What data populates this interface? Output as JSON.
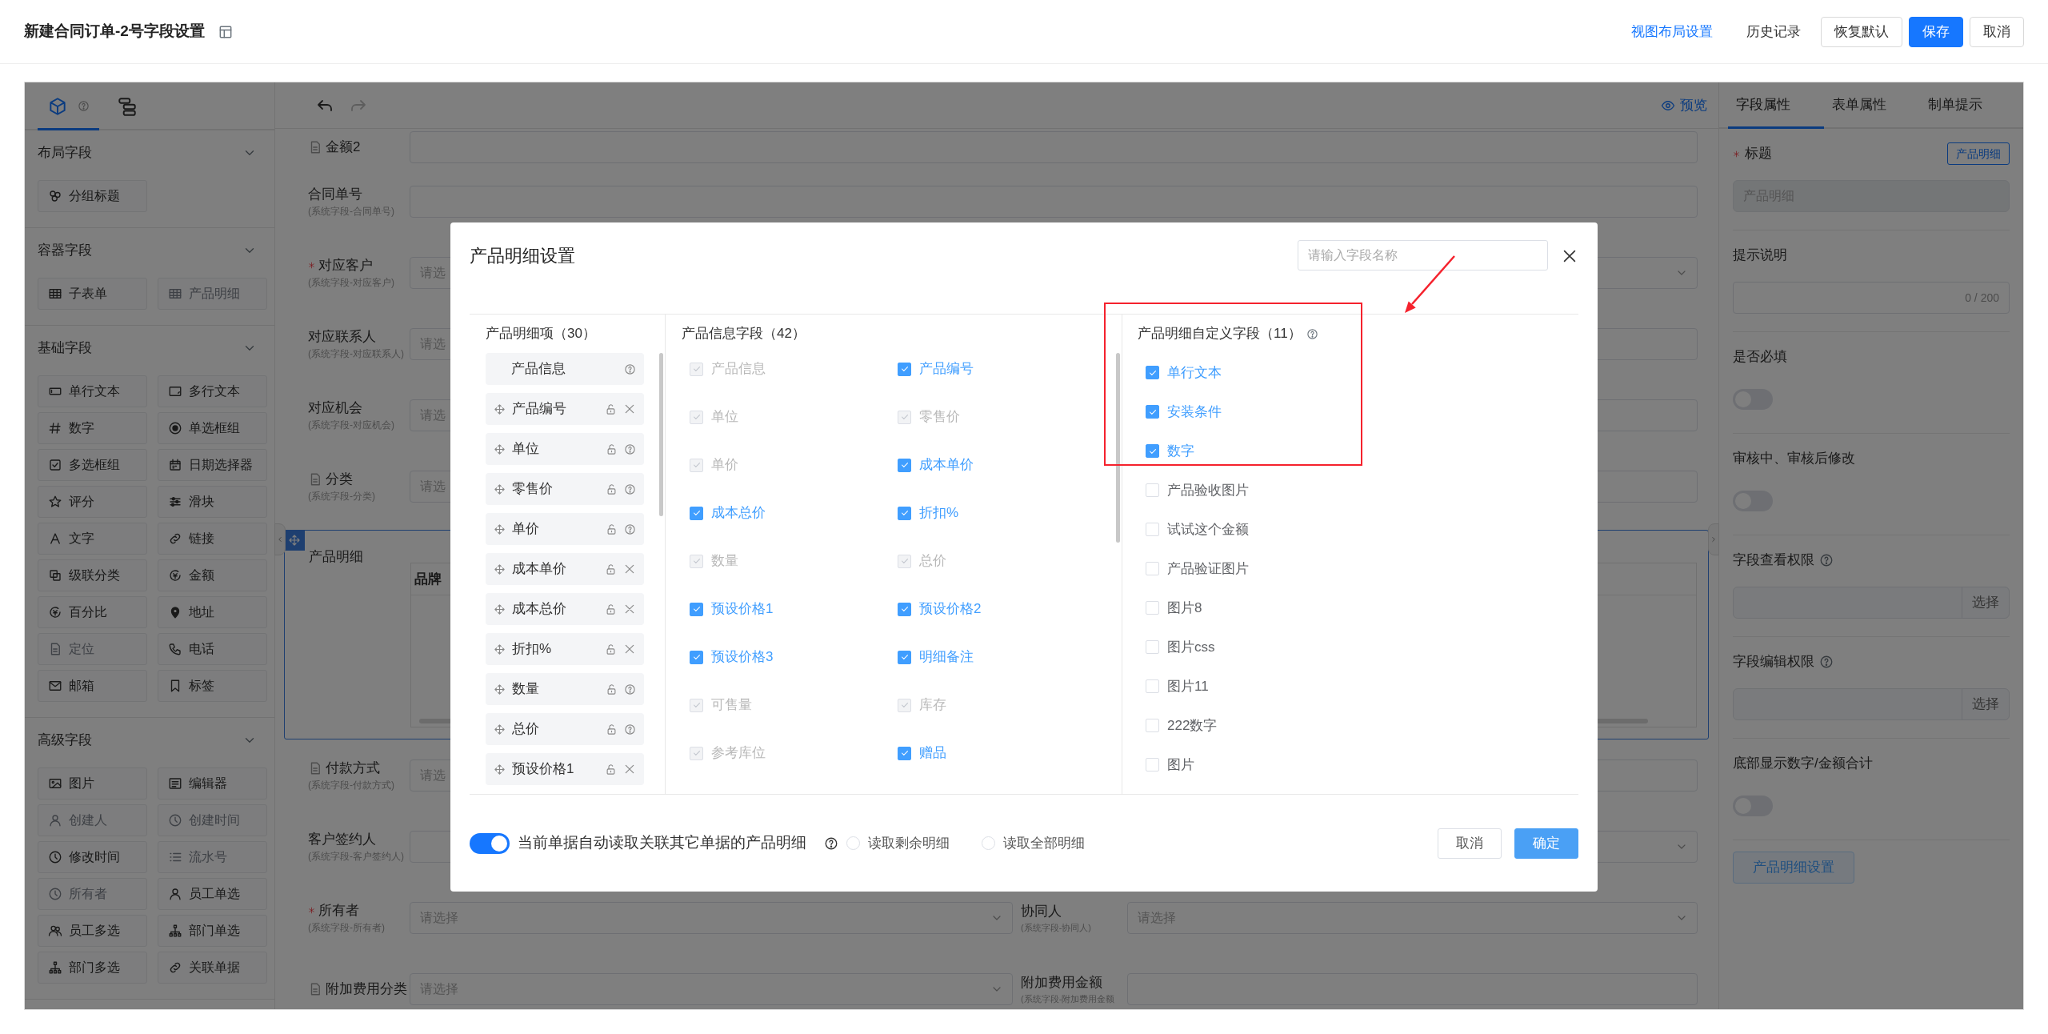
{
  "header": {
    "title": "新建合同订单-2号字段设置",
    "actions": [
      {
        "label": "视图布局设置",
        "kind": "link"
      },
      {
        "label": "历史记录",
        "kind": "text"
      },
      {
        "label": "恢复默认",
        "kind": "outline"
      },
      {
        "label": "保存",
        "kind": "primary"
      },
      {
        "label": "取消",
        "kind": "outline"
      }
    ]
  },
  "sidebar": {
    "tabs": [
      {
        "selected": true
      },
      {
        "selected": false
      }
    ],
    "sections": [
      {
        "title": "布局字段",
        "expanded": true,
        "items": [
          {
            "label": "分组标题",
            "disabled": false
          }
        ]
      },
      {
        "title": "容器字段",
        "expanded": true,
        "items": [
          {
            "label": "子表单",
            "disabled": false
          },
          {
            "label": "产品明细",
            "disabled": true
          }
        ]
      },
      {
        "title": "基础字段",
        "expanded": true,
        "items": [
          {
            "label": "单行文本",
            "disabled": false
          },
          {
            "label": "多行文本",
            "disabled": false
          },
          {
            "label": "数字",
            "disabled": false
          },
          {
            "label": "单选框组",
            "disabled": false
          },
          {
            "label": "多选框组",
            "disabled": false
          },
          {
            "label": "日期选择器",
            "disabled": false
          },
          {
            "label": "评分",
            "disabled": false
          },
          {
            "label": "滑块",
            "disabled": false
          },
          {
            "label": "文字",
            "disabled": false
          },
          {
            "label": "链接",
            "disabled": false
          },
          {
            "label": "级联分类",
            "disabled": false
          },
          {
            "label": "金额",
            "disabled": false
          },
          {
            "label": "百分比",
            "disabled": false
          },
          {
            "label": "地址",
            "disabled": false
          },
          {
            "label": "定位",
            "disabled": true
          },
          {
            "label": "电话",
            "disabled": false
          },
          {
            "label": "邮箱",
            "disabled": false
          },
          {
            "label": "标签",
            "disabled": false
          }
        ]
      },
      {
        "title": "高级字段",
        "expanded": true,
        "items": [
          {
            "label": "图片",
            "disabled": false
          },
          {
            "label": "编辑器",
            "disabled": false
          },
          {
            "label": "创建人",
            "disabled": true
          },
          {
            "label": "创建时间",
            "disabled": true
          },
          {
            "label": "修改时间",
            "disabled": false
          },
          {
            "label": "流水号",
            "disabled": true
          },
          {
            "label": "所有者",
            "disabled": true
          },
          {
            "label": "员工单选",
            "disabled": false
          },
          {
            "label": "员工多选",
            "disabled": false
          },
          {
            "label": "部门单选",
            "disabled": false
          },
          {
            "label": "部门多选",
            "disabled": false
          },
          {
            "label": "关联单据",
            "disabled": false
          }
        ]
      }
    ]
  },
  "canvas": {
    "preview": "预览",
    "rows": [
      {
        "kind": "full",
        "label": "金额2",
        "note": true
      },
      {
        "kind": "full",
        "label": "合同单号",
        "sub": "(系统字段-合同单号)"
      },
      {
        "kind": "pair",
        "label": "对应客户",
        "required": true,
        "sub": "(系统字段-对应客户)",
        "placeholder": "请选",
        "right": {
          "dropdown": true
        }
      },
      {
        "kind": "pair",
        "label": "对应联系人",
        "sub": "(系统字段-对应联系人)",
        "placeholder": "请选",
        "right": {}
      },
      {
        "kind": "pair",
        "label": "对应机会",
        "sub": "(系统字段-对应机会)",
        "placeholder": "请选",
        "right": {}
      },
      {
        "kind": "pair",
        "label": "分类",
        "note": true,
        "sub": "(系统字段-分类)",
        "placeholder": "请选",
        "right": {}
      },
      {
        "kind": "table",
        "label": "产品明细",
        "selected": true,
        "columns": [
          "品牌"
        ]
      },
      {
        "kind": "pair",
        "label": "付款方式",
        "note": true,
        "sub": "(系统字段-付款方式)",
        "placeholder": "请选",
        "right": {}
      },
      {
        "kind": "pair",
        "label": "客户签约人",
        "sub": "(系统字段-客户签约人)",
        "right": {
          "dropdown": true
        }
      },
      {
        "kind": "pair",
        "label": "所有者",
        "required": true,
        "sub": "(系统字段-所有者)",
        "placeholder": "请选择",
        "dropdown": true,
        "right": {
          "label": "协同人",
          "sub": "(系统字段-协同人)",
          "placeholder": "请选择",
          "dropdown": true
        }
      },
      {
        "kind": "pair",
        "label": "附加费用分类",
        "note": true,
        "placeholder": "请选择",
        "dropdown": true,
        "right": {
          "label": "附加费用金额",
          "sub": "(系统字段-附加费用金额"
        }
      }
    ]
  },
  "properties": {
    "tabs": [
      {
        "label": "字段属性",
        "selected": true
      },
      {
        "label": "表单属性",
        "selected": false
      },
      {
        "label": "制单提示",
        "selected": false
      }
    ],
    "items": [
      {
        "kind": "title",
        "label": "标题",
        "required": true,
        "tag": "产品明细",
        "value": "产品明细"
      },
      {
        "kind": "textarea",
        "label": "提示说明",
        "counter": "0 / 200"
      },
      {
        "kind": "switch",
        "label": "是否必填",
        "on": false
      },
      {
        "kind": "switch",
        "label": "审核中、审核后修改",
        "on": false
      },
      {
        "kind": "picker",
        "label": "字段查看权限",
        "help": true,
        "button": "选择"
      },
      {
        "kind": "picker",
        "label": "字段编辑权限",
        "help": true,
        "button": "选择"
      },
      {
        "kind": "switch",
        "label": "底部显示数字/金额合计",
        "on": false
      },
      {
        "kind": "button",
        "label": "产品明细设置"
      }
    ]
  },
  "modal": {
    "title": "产品明细设置",
    "search": {
      "placeholder": "请输入字段名称"
    },
    "columns": [
      {
        "kind": "order",
        "title": "产品明细项（30）",
        "items": [
          {
            "label": "产品信息",
            "draggable": false,
            "removable": false
          },
          {
            "label": "产品编号",
            "draggable": true,
            "removable": true
          },
          {
            "label": "单位",
            "draggable": true,
            "removable": false
          },
          {
            "label": "零售价",
            "draggable": true,
            "removable": false
          },
          {
            "label": "单价",
            "draggable": true,
            "removable": false
          },
          {
            "label": "成本单价",
            "draggable": true,
            "removable": true
          },
          {
            "label": "成本总价",
            "draggable": true,
            "removable": true
          },
          {
            "label": "折扣%",
            "draggable": true,
            "removable": true
          },
          {
            "label": "数量",
            "draggable": true,
            "removable": false
          },
          {
            "label": "总价",
            "draggable": true,
            "removable": false
          },
          {
            "label": "预设价格1",
            "draggable": true,
            "removable": true
          }
        ]
      },
      {
        "kind": "grid",
        "title": "产品信息字段（42）",
        "items": [
          {
            "label": "产品信息",
            "checked": true,
            "disabled": true
          },
          {
            "label": "产品编号",
            "checked": true,
            "disabled": false
          },
          {
            "label": "单位",
            "checked": true,
            "disabled": true
          },
          {
            "label": "零售价",
            "checked": true,
            "disabled": true
          },
          {
            "label": "单价",
            "checked": true,
            "disabled": true
          },
          {
            "label": "成本单价",
            "checked": true,
            "disabled": false
          },
          {
            "label": "成本总价",
            "checked": true,
            "disabled": false
          },
          {
            "label": "折扣%",
            "checked": true,
            "disabled": false
          },
          {
            "label": "数量",
            "checked": true,
            "disabled": true
          },
          {
            "label": "总价",
            "checked": true,
            "disabled": true
          },
          {
            "label": "预设价格1",
            "checked": true,
            "disabled": false
          },
          {
            "label": "预设价格2",
            "checked": true,
            "disabled": false
          },
          {
            "label": "预设价格3",
            "checked": true,
            "disabled": false
          },
          {
            "label": "明细备注",
            "checked": true,
            "disabled": false
          },
          {
            "label": "可售量",
            "checked": true,
            "disabled": true
          },
          {
            "label": "库存",
            "checked": true,
            "disabled": true
          },
          {
            "label": "参考库位",
            "checked": true,
            "disabled": true
          },
          {
            "label": "赠品",
            "checked": true,
            "disabled": false
          }
        ]
      },
      {
        "kind": "list",
        "title": "产品明细自定义字段（11）",
        "help": true,
        "items": [
          {
            "label": "单行文本",
            "checked": true
          },
          {
            "label": "安装条件",
            "checked": true
          },
          {
            "label": "数字",
            "checked": true
          },
          {
            "label": "产品验收图片",
            "checked": false
          },
          {
            "label": "试试这个金额",
            "checked": false
          },
          {
            "label": "产品验证图片",
            "checked": false
          },
          {
            "label": "图片8",
            "checked": false
          },
          {
            "label": "图片css",
            "checked": false
          },
          {
            "label": "图片11",
            "checked": false
          },
          {
            "label": "222数字",
            "checked": false
          },
          {
            "label": "图片",
            "checked": false
          }
        ]
      }
    ],
    "auto_read": {
      "label": "当前单据自动读取关联其它单据的产品明细",
      "on": true
    },
    "read_modes": [
      {
        "label": "读取剩余明细",
        "selected": false
      },
      {
        "label": "读取全部明细",
        "selected": false
      }
    ],
    "buttons": [
      {
        "label": "取消",
        "kind": "default"
      },
      {
        "label": "确定",
        "kind": "primary"
      }
    ]
  }
}
